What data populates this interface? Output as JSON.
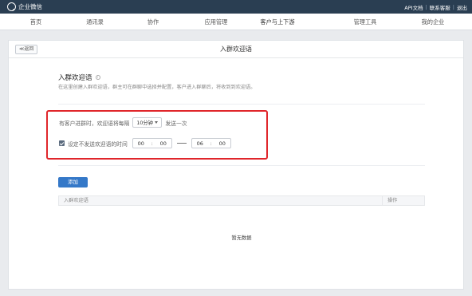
{
  "topbar": {
    "brand": "企业微信",
    "links": [
      "API文档",
      "联系客服",
      "退出"
    ]
  },
  "nav": {
    "items": [
      "首页",
      "通讯录",
      "协作",
      "应用管理",
      "客户与上下游",
      "管理工具",
      "我的企业"
    ],
    "active": "客户与上下游"
  },
  "panel": {
    "back_label": "≪返回",
    "title": "入群欢迎语"
  },
  "section": {
    "title": "入群欢迎语",
    "description": "在这里创建入群欢迎语，群主可在群聊中选择并配置，客户进入群聊后，将收到到欢迎语。"
  },
  "settings": {
    "interval_prefix": "有客户进群时，欢迎语将每隔",
    "interval_value": "10分钟",
    "interval_suffix": "发送一次",
    "quiet_checked": true,
    "quiet_label": "设定不发送欢迎语的时间",
    "start_hour": "00",
    "start_minute": "00",
    "end_hour": "06",
    "end_minute": "00"
  },
  "actions": {
    "add_label": "添加"
  },
  "table": {
    "col_name": "入群欢迎语",
    "col_action": "操作",
    "empty_text": "暂无数据"
  },
  "colors": {
    "topbar": "#2a3e52",
    "accent": "#3478c8",
    "highlight": "#e0262b"
  }
}
